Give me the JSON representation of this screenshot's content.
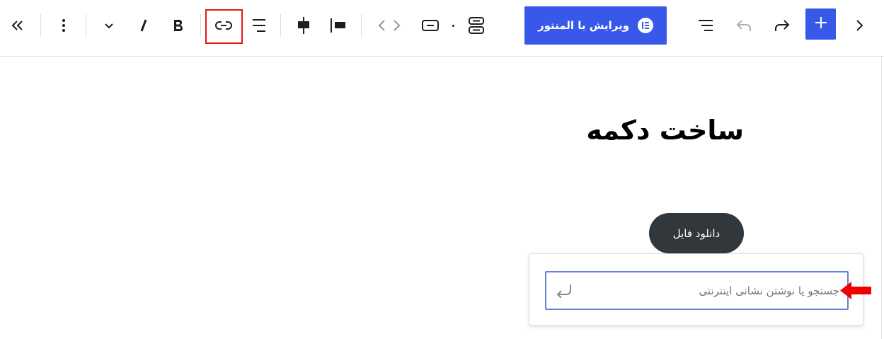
{
  "toolbar": {
    "elementor_button_label": "ویرایش با المنتور",
    "icons": [
      "collapse-double-chevron-icon",
      "more-options-icon",
      "chevron-down-icon",
      "italic-icon",
      "bold-icon",
      "link-icon",
      "justify-text-icon",
      "align-center-icon",
      "align-left-icon",
      "code-icon",
      "button-block-icon",
      "buttons-group-icon",
      "elementor-logo-icon",
      "list-view-icon",
      "undo-icon",
      "redo-icon",
      "add-block-icon",
      "chevron-right-icon"
    ]
  },
  "content": {
    "heading": "ساخت دکمه",
    "button_label": "دانلود فایل"
  },
  "link_popover": {
    "placeholder": "جستجو یا نوشتن نشانی اینترنتی",
    "value": ""
  },
  "colors": {
    "accent": "#3858e9",
    "button_bg": "#32373c",
    "highlight": "#e0191b",
    "input_border": "#6b7fd7"
  }
}
